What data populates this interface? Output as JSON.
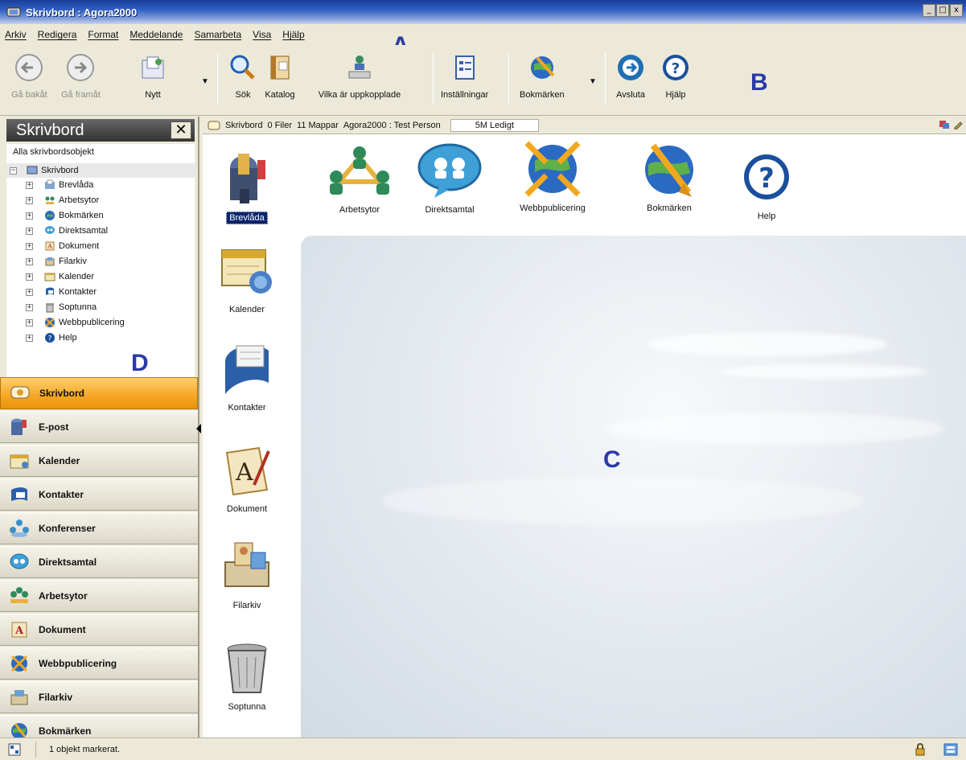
{
  "window": {
    "title": "Skrivbord : Agora2000",
    "min": "_",
    "max": "□",
    "close": "x"
  },
  "menu": [
    "Arkiv",
    "Redigera",
    "Format",
    "Meddelande",
    "Samarbeta",
    "Visa",
    "Hjälp"
  ],
  "toolbar": {
    "back": "Gå bakåt",
    "forward": "Gå framåt",
    "new": "Nytt",
    "search": "Sök",
    "catalog": "Katalog",
    "online": "Vilka är uppkopplade",
    "settings": "Inställningar",
    "bookmarks": "Bokmärken",
    "exit": "Avsluta",
    "help": "Hjälp"
  },
  "callouts": {
    "a": "A",
    "b": "B",
    "c": "C",
    "d": "D"
  },
  "left_pane": {
    "title": "Skrivbord",
    "close": "✕",
    "tree_all": "Alla skrivbordsobjekt",
    "tree_root": "Skrivbord",
    "tree_items": [
      "Brevlåda",
      "Arbetsytor",
      "Bokmärken",
      "Direktsamtal",
      "Dokument",
      "Filarkiv",
      "Kalender",
      "Kontakter",
      "Soptunna",
      "Webbpublicering",
      "Help"
    ]
  },
  "nav": [
    "Skrivbord",
    "E-post",
    "Kalender",
    "Kontakter",
    "Konferenser",
    "Direktsamtal",
    "Arbetsytor",
    "Dokument",
    "Webbpublicering",
    "Filarkiv",
    "Bokmärken"
  ],
  "address": {
    "path": "Skrivbord",
    "files": "0 Filer",
    "folders": "11 Mappar",
    "user": "Agora2000 : Test Person",
    "free": "5M Ledigt"
  },
  "desktop_top": [
    "Brevlåda",
    "Arbetsytor",
    "Direktsamtal",
    "Webbpublicering",
    "Bokmärken",
    "Help"
  ],
  "desktop_left": [
    "Kalender",
    "Kontakter",
    "Dokument",
    "Filarkiv",
    "Soptunna"
  ],
  "status": {
    "text": "1 objekt markerat."
  },
  "colors": {
    "accent": "#f6a623",
    "titlebar": "#2f5fc4",
    "callout": "#2a39a8"
  }
}
